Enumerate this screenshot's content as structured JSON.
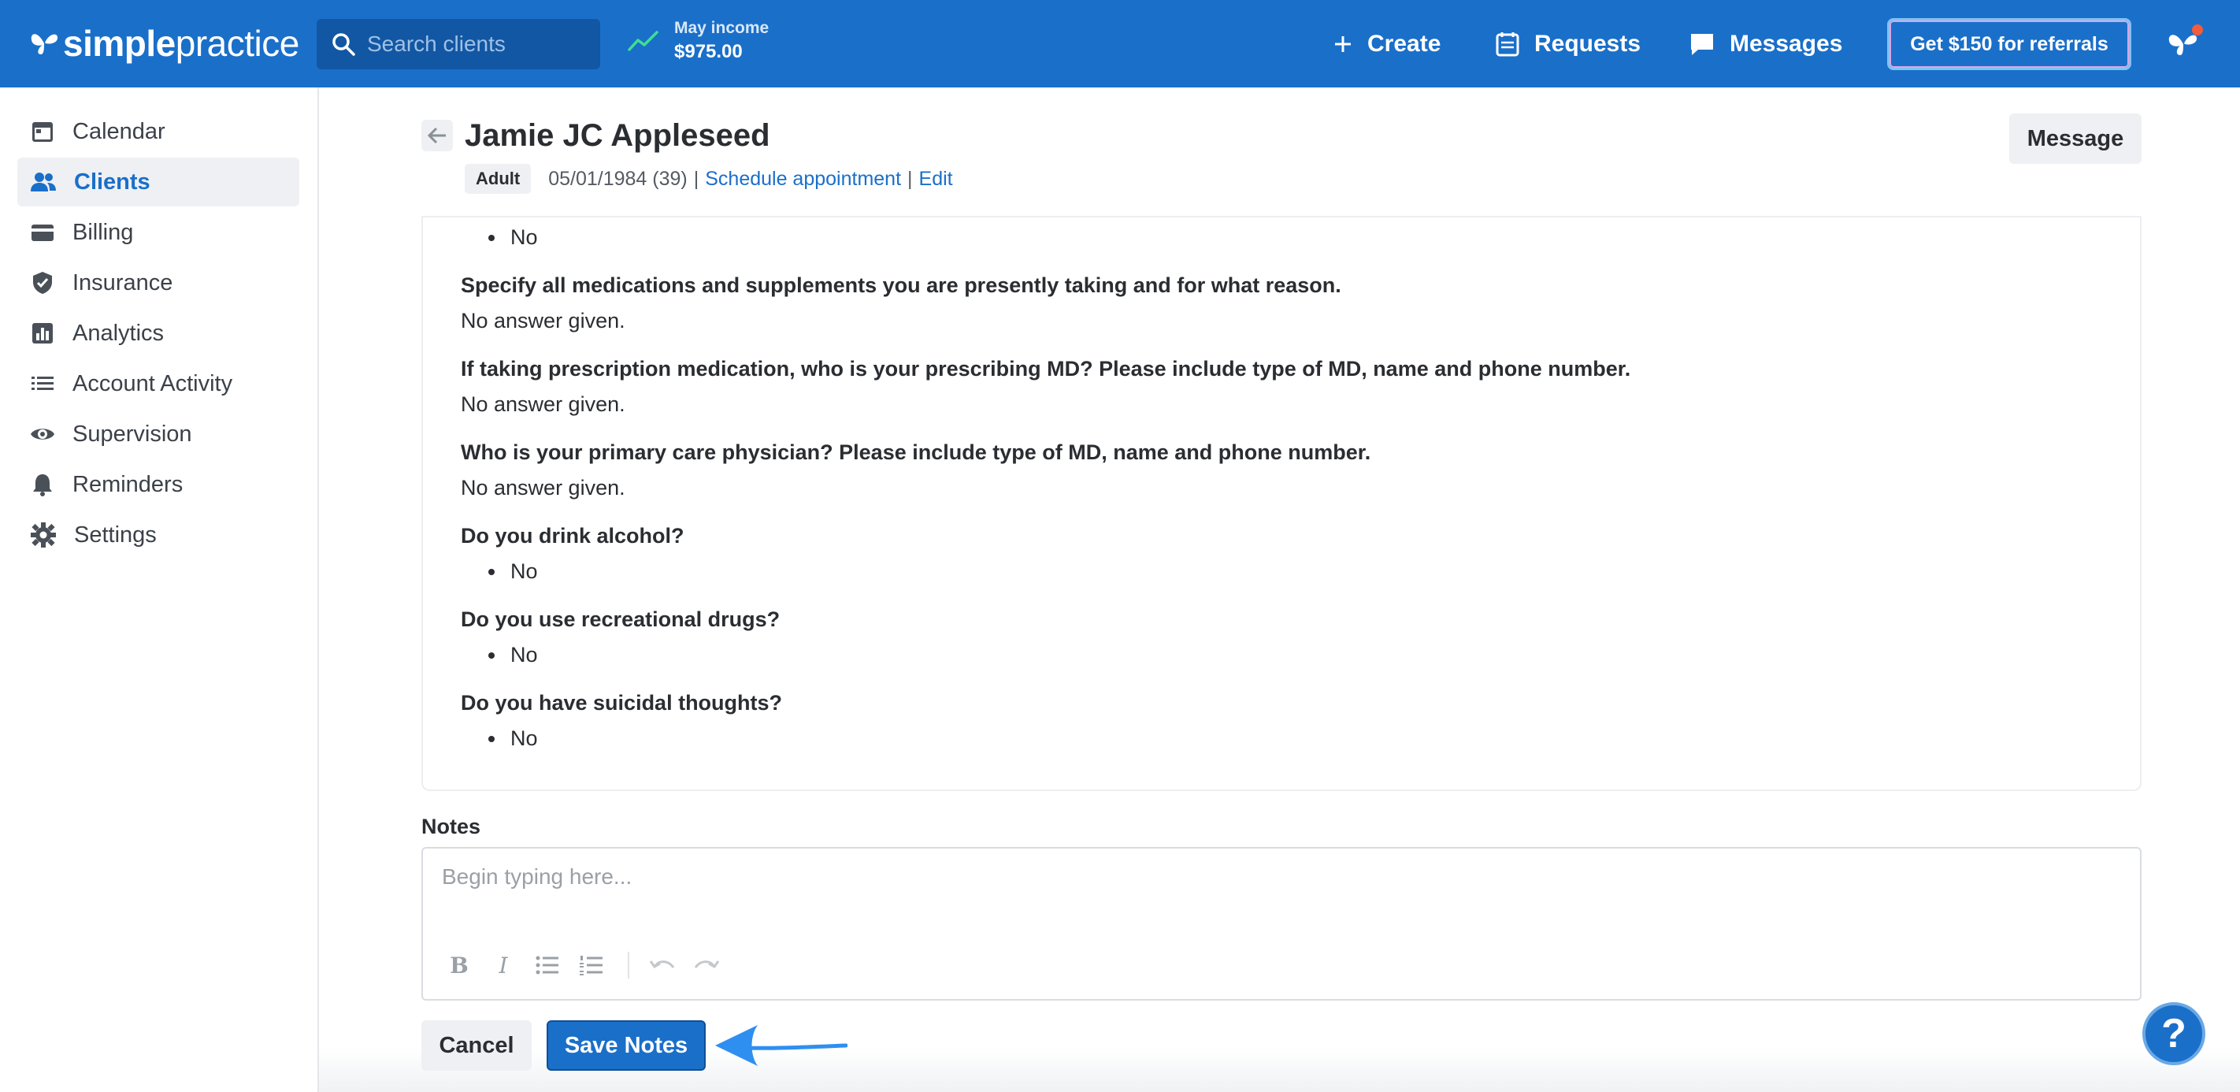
{
  "brand": {
    "bold": "simple",
    "light": "practice"
  },
  "search": {
    "placeholder": "Search clients"
  },
  "income": {
    "label": "May income",
    "amount": "$975.00"
  },
  "nav": {
    "create": "Create",
    "requests": "Requests",
    "messages": "Messages",
    "referral": "Get $150 for referrals"
  },
  "sidebar": {
    "items": [
      {
        "label": "Calendar",
        "icon": "calendar-icon"
      },
      {
        "label": "Clients",
        "icon": "clients-icon",
        "active": true
      },
      {
        "label": "Billing",
        "icon": "credit-card-icon"
      },
      {
        "label": "Insurance",
        "icon": "shield-icon"
      },
      {
        "label": "Analytics",
        "icon": "bar-chart-icon"
      },
      {
        "label": "Account Activity",
        "icon": "list-icon"
      },
      {
        "label": "Supervision",
        "icon": "eye-icon"
      },
      {
        "label": "Reminders",
        "icon": "bell-icon"
      },
      {
        "label": "Settings",
        "icon": "gear-icon"
      }
    ]
  },
  "client": {
    "name": "Jamie JC Appleseed",
    "badge": "Adult",
    "dob": "05/01/1984 (39)",
    "schedule_link": "Schedule appointment",
    "edit_link": "Edit",
    "message_button": "Message"
  },
  "questionnaire": {
    "top_answer": "No",
    "items": [
      {
        "question": "Specify all medications and supplements you are presently taking and for what reason.",
        "answer": "No answer given."
      },
      {
        "question": "If taking prescription medication, who is your prescribing MD? Please include type of MD, name and phone number.",
        "answer": "No answer given."
      },
      {
        "question": "Who is your primary care physician? Please include type of MD, name and phone number.",
        "answer": "No answer given."
      },
      {
        "question": "Do you drink alcohol?",
        "bullet": "No"
      },
      {
        "question": "Do you use recreational drugs?",
        "bullet": "No"
      },
      {
        "question": "Do you have suicidal thoughts?",
        "bullet": "No"
      }
    ]
  },
  "notes": {
    "label": "Notes",
    "placeholder": "Begin typing here...",
    "toolbar": {
      "bold": "B",
      "italic": "I"
    },
    "cancel": "Cancel",
    "save": "Save Notes"
  },
  "help": "?",
  "colors": {
    "brand": "#1a6fc9",
    "annotation_arrow": "#2f8ff0"
  }
}
